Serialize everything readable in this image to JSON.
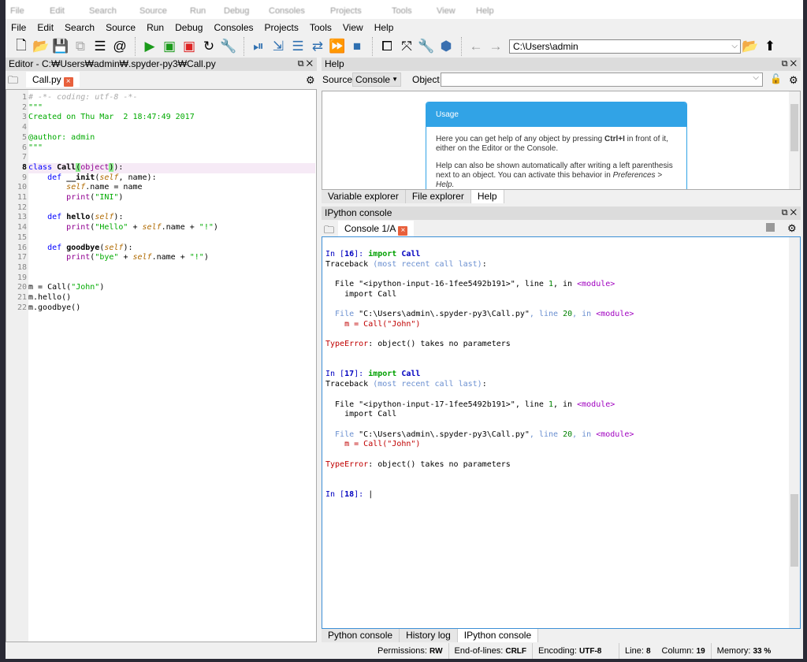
{
  "menu": [
    "File",
    "Edit",
    "Search",
    "Source",
    "Run",
    "Debug",
    "Consoles",
    "Projects",
    "Tools",
    "View",
    "Help"
  ],
  "toolbar": {
    "icons": [
      "new-file",
      "open-folder",
      "save",
      "save-all",
      "outline-list",
      "at-sign",
      "run",
      "run-cell",
      "run-cell-advance",
      "rerun",
      "run-settings",
      "debug-step",
      "debug-step-into",
      "debug-step-return",
      "debug-continue",
      "debug-continue-fast",
      "debug-stop",
      "maximize-pane",
      "fullscreen",
      "preferences-wrench",
      "python-path",
      "back-arrow",
      "forward-arrow"
    ],
    "path": "C:\\Users\\admin"
  },
  "editor": {
    "title": "Editor - C:₩Users₩admin₩.spyder-py3₩Call.py",
    "tab": "Call.py",
    "lines": [
      [
        [
          "c",
          "# -*- coding: utf-8 -*-"
        ]
      ],
      [
        [
          "s",
          "\"\"\""
        ]
      ],
      [
        [
          "s",
          "Created on Thu Mar  2 18:47:49 2017"
        ]
      ],
      [],
      [
        [
          "s",
          "@author: admin"
        ]
      ],
      [
        [
          "s",
          "\"\"\""
        ]
      ],
      [],
      [
        [
          "k",
          "class "
        ],
        [
          "bold",
          "Call"
        ],
        [
          "hl",
          "("
        ],
        [
          "b",
          "object"
        ],
        [
          "hl",
          ")"
        ],
        [
          "",
          "):"
        ]
      ],
      [
        [
          "",
          "    "
        ],
        [
          "k",
          "def "
        ],
        [
          "bold",
          "__init"
        ],
        [
          "",
          "("
        ],
        [
          "self",
          "self"
        ],
        [
          "",
          ", name):"
        ]
      ],
      [
        [
          "",
          "        "
        ],
        [
          "self",
          "self"
        ],
        [
          "",
          ".name = name"
        ]
      ],
      [
        [
          "",
          "        "
        ],
        [
          "b",
          "print"
        ],
        [
          "",
          "("
        ],
        [
          "s",
          "\"INI\""
        ],
        [
          "",
          ")"
        ]
      ],
      [],
      [
        [
          "",
          "    "
        ],
        [
          "k",
          "def "
        ],
        [
          "bold",
          "hello"
        ],
        [
          "",
          "("
        ],
        [
          "self",
          "self"
        ],
        [
          "",
          "):"
        ]
      ],
      [
        [
          "",
          "        "
        ],
        [
          "b",
          "print"
        ],
        [
          "",
          "("
        ],
        [
          "s",
          "\"Hello\""
        ],
        [
          "",
          " + "
        ],
        [
          "self",
          "self"
        ],
        [
          "",
          ".name + "
        ],
        [
          "s",
          "\"!\""
        ],
        [
          "",
          ")"
        ]
      ],
      [],
      [
        [
          "",
          "    "
        ],
        [
          "k",
          "def "
        ],
        [
          "bold",
          "goodbye"
        ],
        [
          "",
          "("
        ],
        [
          "self",
          "self"
        ],
        [
          "",
          "):"
        ]
      ],
      [
        [
          "",
          "        "
        ],
        [
          "b",
          "print"
        ],
        [
          "",
          "("
        ],
        [
          "s",
          "\"bye\""
        ],
        [
          "",
          " + "
        ],
        [
          "self",
          "self"
        ],
        [
          "",
          ".name + "
        ],
        [
          "s",
          "\"!\""
        ],
        [
          "",
          ")"
        ]
      ],
      [],
      [],
      [
        [
          "",
          "m = Call("
        ],
        [
          "s",
          "\"John\""
        ],
        [
          "",
          ")"
        ]
      ],
      [
        [
          "",
          "m.hello()"
        ]
      ],
      [
        [
          "",
          "m.goodbye()"
        ]
      ]
    ],
    "current_line": 8
  },
  "help": {
    "title": "Help",
    "source_label": "Source",
    "source_value": "Console",
    "object_label": "Object",
    "object_value": "",
    "card_title": "Usage",
    "p1a": "Here you can get help of any object by pressing ",
    "p1b": "Ctrl+I",
    "p1c": " in front of it, either on the Editor or the Console.",
    "p2": "Help can also be shown automatically after writing a left parenthesis next to an object. You can activate this behavior in ",
    "p2i": "Preferences > Help.",
    "tabs": [
      "Variable explorer",
      "File explorer",
      "Help"
    ],
    "active_tab": "Help"
  },
  "console": {
    "title": "IPython console",
    "tab": "Console 1/A",
    "lines": [
      [
        [
          "in",
          "In ["
        ],
        [
          "tc",
          "16"
        ],
        [
          "in",
          "]: "
        ],
        [
          "g",
          "import "
        ],
        [
          "tc",
          "Call"
        ]
      ],
      [
        [
          "",
          "Traceback "
        ],
        [
          "dim",
          "(most recent call last)"
        ],
        [
          "",
          ":"
        ]
      ],
      [],
      [
        [
          "",
          "  File \"<ipython-input-16-1fee5492b191>\", line "
        ],
        [
          "num",
          "1"
        ],
        [
          "",
          ", in "
        ],
        [
          "mod",
          "<module>"
        ]
      ],
      [
        [
          "",
          "    import Call"
        ]
      ],
      [],
      [
        [
          "dim",
          "  File "
        ],
        [
          "",
          "\"C:\\Users\\admin\\.spyder-py3\\Call.py\""
        ],
        [
          "dim",
          ", line "
        ],
        [
          "num",
          "20"
        ],
        [
          "dim",
          ", in "
        ],
        [
          "mod",
          "<module>"
        ]
      ],
      [
        [
          "red",
          "    m = "
        ],
        [
          "red",
          "Call(\"John\")"
        ]
      ],
      [],
      [
        [
          "red",
          "TypeError"
        ],
        [
          "",
          ": object() takes no parameters"
        ]
      ],
      [],
      [],
      [
        [
          "in",
          "In ["
        ],
        [
          "tc",
          "17"
        ],
        [
          "in",
          "]: "
        ],
        [
          "g",
          "import "
        ],
        [
          "tc",
          "Call"
        ]
      ],
      [
        [
          "",
          "Traceback "
        ],
        [
          "dim",
          "(most recent call last)"
        ],
        [
          "",
          ":"
        ]
      ],
      [],
      [
        [
          "",
          "  File \"<ipython-input-17-1fee5492b191>\", line "
        ],
        [
          "num",
          "1"
        ],
        [
          "",
          ", in "
        ],
        [
          "mod",
          "<module>"
        ]
      ],
      [
        [
          "",
          "    import Call"
        ]
      ],
      [],
      [
        [
          "dim",
          "  File "
        ],
        [
          "",
          "\"C:\\Users\\admin\\.spyder-py3\\Call.py\""
        ],
        [
          "dim",
          ", line "
        ],
        [
          "num",
          "20"
        ],
        [
          "dim",
          ", in "
        ],
        [
          "mod",
          "<module>"
        ]
      ],
      [
        [
          "red",
          "    m = "
        ],
        [
          "red",
          "Call(\"John\")"
        ]
      ],
      [],
      [
        [
          "red",
          "TypeError"
        ],
        [
          "",
          ": object() takes no parameters"
        ]
      ],
      [],
      [],
      [
        [
          "in",
          "In ["
        ],
        [
          "tc",
          "18"
        ],
        [
          "in",
          "]: "
        ],
        [
          "",
          "|"
        ]
      ]
    ],
    "tabs": [
      "Python console",
      "History log",
      "IPython console"
    ],
    "active_tab": "IPython console"
  },
  "status": {
    "perm_label": "Permissions:",
    "perm": "RW",
    "eol_label": "End-of-lines:",
    "eol": "CRLF",
    "enc_label": "Encoding:",
    "enc": "UTF-8",
    "line_label": "Line:",
    "line": "8",
    "col_label": "Column:",
    "col": "19",
    "mem_label": "Memory:",
    "mem": "33 %"
  }
}
